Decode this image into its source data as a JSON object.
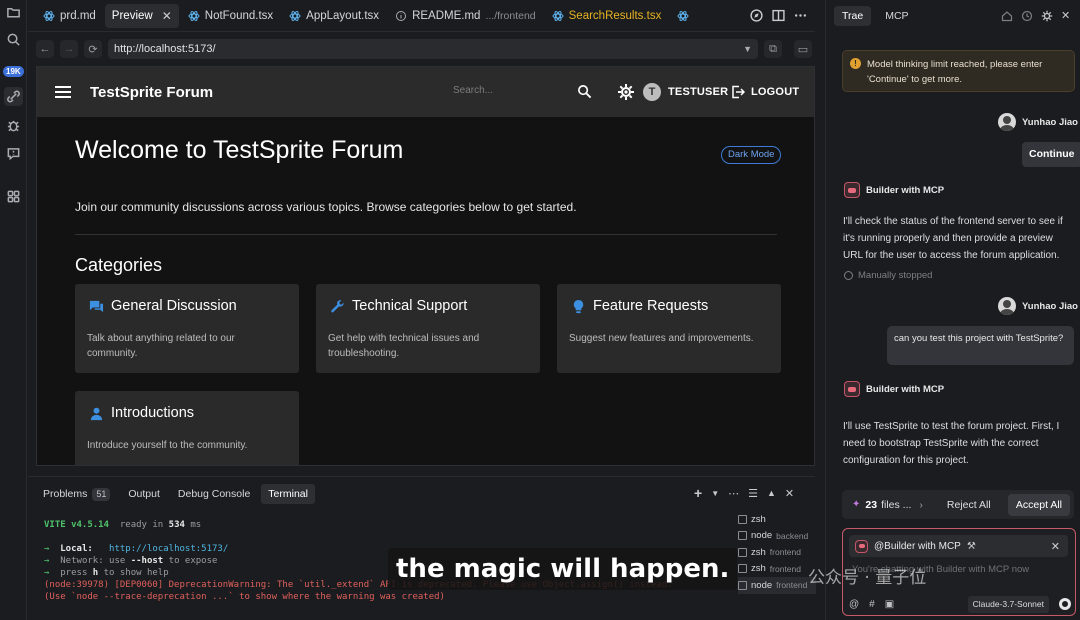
{
  "activity_bar": {
    "badge": "19K"
  },
  "tabs": [
    {
      "label": "prd.md",
      "sub": ""
    },
    {
      "label": "Preview",
      "sub": ""
    },
    {
      "label": "NotFound.tsx",
      "sub": ""
    },
    {
      "label": "AppLayout.tsx",
      "sub": ""
    },
    {
      "label": "README.md",
      "sub": ".../frontend"
    },
    {
      "label": "SearchResults.tsx",
      "sub": ""
    }
  ],
  "browser": {
    "url": "http://localhost:5173/"
  },
  "app": {
    "brand": "TestSprite Forum",
    "search_placeholder": "Search...",
    "avatar_letter": "T",
    "username": "TESTUSER",
    "logout": "LOGOUT",
    "welcome": "Welcome to TestSprite Forum",
    "dark_mode": "Dark Mode",
    "intro": "Join our community discussions across various topics. Browse categories below to get started.",
    "categories_title": "Categories",
    "categories": [
      {
        "title": "General Discussion",
        "desc": "Talk about anything related to our community.",
        "icon": "forum-icon",
        "color": "#3d8fe0"
      },
      {
        "title": "Technical Support",
        "desc": "Get help with technical issues and troubleshooting.",
        "icon": "wrench-icon",
        "color": "#3d8fe0"
      },
      {
        "title": "Feature Requests",
        "desc": "Suggest new features and improvements.",
        "icon": "lightbulb-icon",
        "color": "#3d8fe0"
      },
      {
        "title": "Introductions",
        "desc": "Introduce yourself to the community.",
        "icon": "person-icon",
        "color": "#3d8fe0"
      }
    ]
  },
  "panel": {
    "tabs": [
      {
        "label": "Problems",
        "badge": "51"
      },
      {
        "label": "Output",
        "badge": ""
      },
      {
        "label": "Debug Console",
        "badge": ""
      },
      {
        "label": "Terminal",
        "badge": ""
      }
    ],
    "terminal": {
      "vite": "VITE v4.5.14",
      "ready": "ready in",
      "ms_value": "534",
      "ms": "ms",
      "local_label": "Local:",
      "local_url": "http://localhost:5173/",
      "network": "Network: use",
      "network_flag": "--host",
      "network_end": "to expose",
      "press": "press",
      "press_key": "h",
      "press_end": "to show help",
      "err1": "(node:39978) [DEP0060] DeprecationWarning: The `util._extend` API is deprecated. Please use Object.assign() instead.",
      "err2": "(Use `node --trace-deprecation ...` to show where the warning was created)"
    },
    "terminal_list": [
      {
        "name": "zsh",
        "meta": ""
      },
      {
        "name": "node",
        "meta": "backend"
      },
      {
        "name": "zsh",
        "meta": "frontend"
      },
      {
        "name": "zsh",
        "meta": "frontend"
      },
      {
        "name": "node",
        "meta": "frontend"
      }
    ]
  },
  "caption": "the magic will happen.",
  "watermark": "公众号 · 量子位",
  "sidebar": {
    "tabs": [
      "Trae",
      "MCP"
    ],
    "notice": "Model thinking limit reached, please enter 'Continue' to get more.",
    "user_name": "Yunhao Jiao",
    "continue": "Continue",
    "bot_name": "Builder with MCP",
    "bot_msg1": "I'll check the status of the frontend server to see if it's running properly and then provide a preview URL for the user to access the forum application.",
    "stopped": "Manually stopped",
    "user_msg": "can you test this project with TestSprite?",
    "bot_msg2": "I'll use TestSprite to test the forum project. First, I need to bootstrap TestSprite with the correct configuration for this project.",
    "files_count": "23",
    "files_label": "files ...",
    "reject_all": "Reject All",
    "accept_all": "Accept All",
    "mention": "@Builder with MCP",
    "input_placeholder": "You're chatting with Builder with MCP now",
    "model": "Claude-3.7-Sonnet"
  }
}
